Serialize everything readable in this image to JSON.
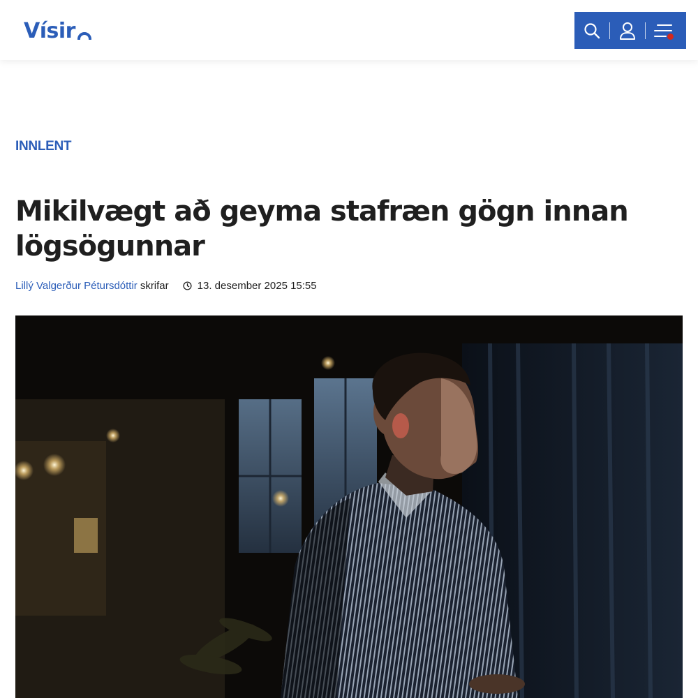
{
  "header": {
    "logo_text": "Vísir",
    "actions": {
      "search_icon": "search-icon",
      "account_icon": "user-icon",
      "menu_icon": "menu-icon"
    },
    "brand_color": "#2b5db8",
    "notification_color": "#d4281c"
  },
  "article": {
    "category": "INNLENT",
    "headline": "Mikilvægt að geyma stafræn gögn innan lög­sögunnar",
    "author": "Lillý Valgerður Pétursdóttir",
    "author_role": "skrifar",
    "published": "13. desember 2025 15:55",
    "hero_image": "photo of a man in a striped shirt in a dim room by windows"
  }
}
